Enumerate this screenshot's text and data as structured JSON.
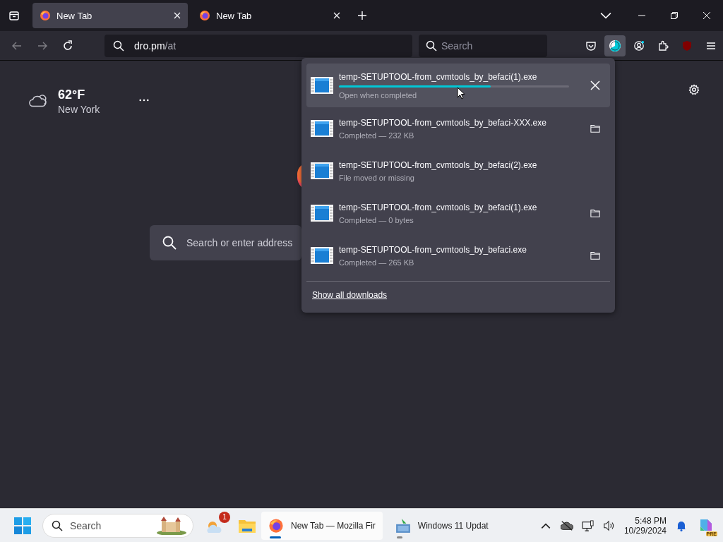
{
  "tabs": [
    {
      "label": "New Tab",
      "selected": true
    },
    {
      "label": "New Tab",
      "selected": false
    }
  ],
  "toolbar": {
    "back_disabled": true,
    "forward_disabled": true,
    "address_host": "dro.pm",
    "address_path": "/at",
    "search_placeholder": "Search",
    "downloads_active": true
  },
  "weather": {
    "temperature": "62°F",
    "city": "New York"
  },
  "page_search": {
    "placeholder": "Search or enter address"
  },
  "downloads": {
    "items": [
      {
        "kind": "progress",
        "name": "temp-SETUPTOOL-from_cvmtools_by_befaci(1).exe",
        "status": "Open when completed",
        "level": 0.66,
        "selected": true
      },
      {
        "kind": "completed",
        "name": "temp-SETUPTOOL-from_cvmtools_by_befaci-XXX.exe",
        "status": "Completed — 232 KB",
        "selected": false
      },
      {
        "kind": "missing",
        "name": "temp-SETUPTOOL-from_cvmtools_by_befaci(2).exe",
        "status": "File moved or missing",
        "selected": false
      },
      {
        "kind": "completed",
        "name": "temp-SETUPTOOL-from_cvmtools_by_befaci(1).exe",
        "status": "Completed — 0 bytes",
        "selected": false
      },
      {
        "kind": "completed",
        "name": "temp-SETUPTOOL-from_cvmtools_by_befaci.exe",
        "status": "Completed — 265 KB",
        "selected": false
      }
    ],
    "show_all": "Show all downloads"
  },
  "taskbar": {
    "search_placeholder": "Search",
    "widgets_badge": "1",
    "apps": [
      {
        "kind": "firefox",
        "label": "New Tab — Mozilla Fir",
        "selected": true
      },
      {
        "kind": "updater",
        "label": "Windows 11 Updat",
        "selected": false
      }
    ],
    "time": "5:48 PM",
    "date": "10/29/2024",
    "copilot_badge": "PRE"
  }
}
